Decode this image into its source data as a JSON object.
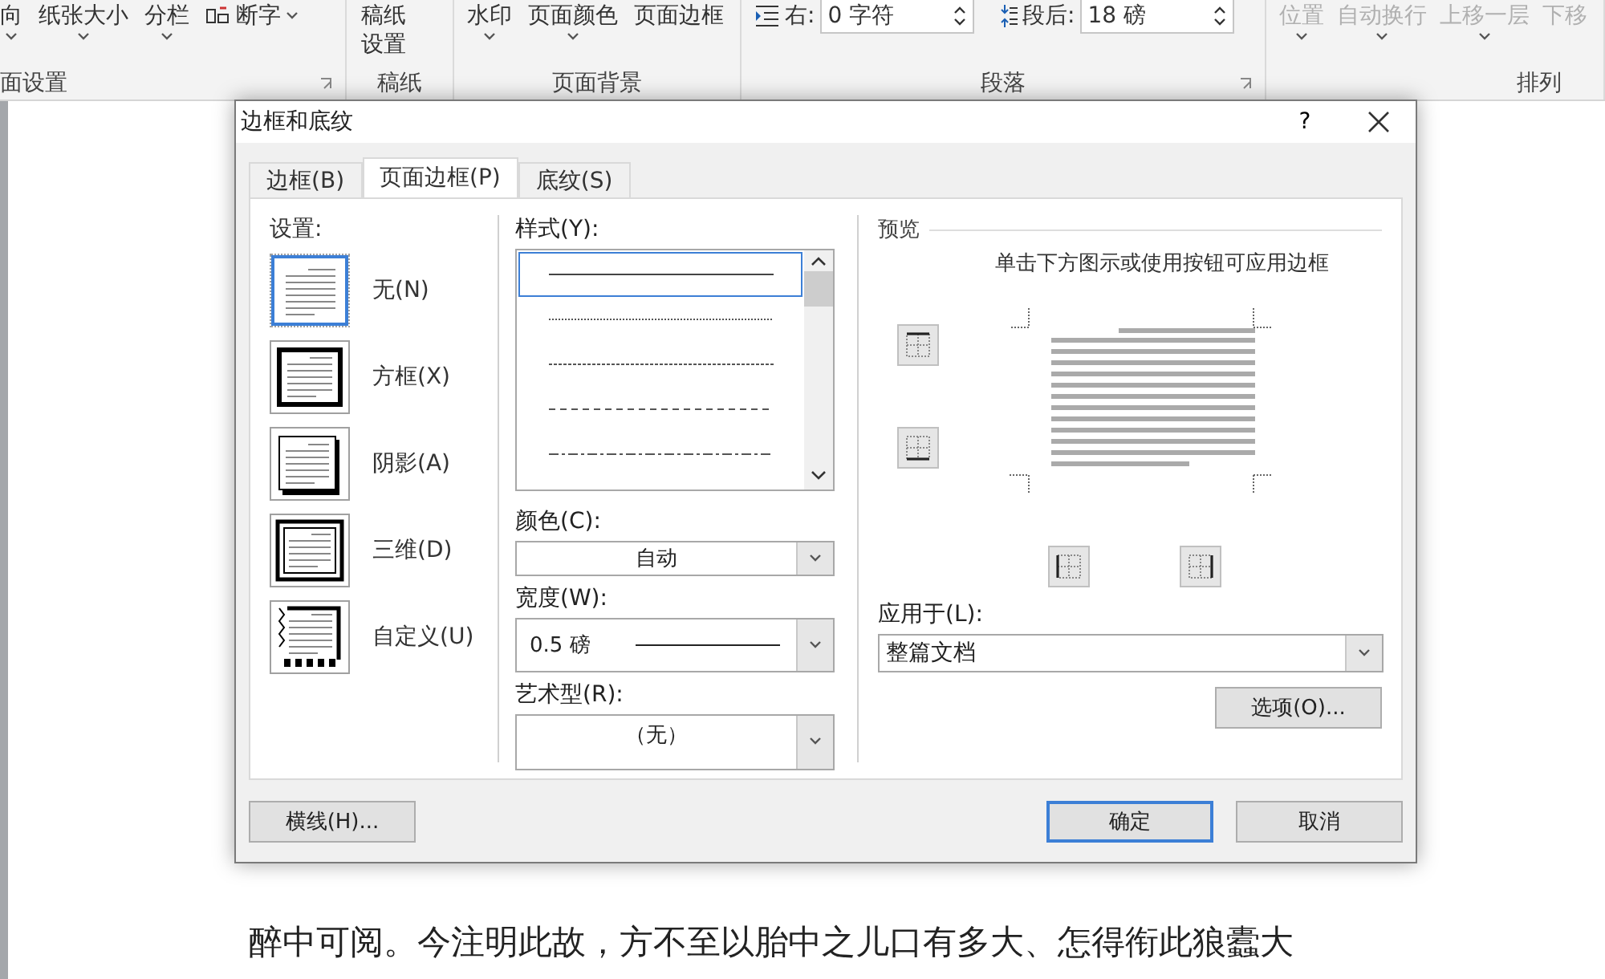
{
  "ribbon": {
    "groups": [
      {
        "label": "面设置",
        "items": [
          {
            "label": "向",
            "kind": "dropdown"
          },
          {
            "label": "纸张大小",
            "kind": "dropdown"
          },
          {
            "label": "分栏",
            "kind": "dropdown"
          },
          {
            "label": "断字",
            "kind": "hyphen"
          }
        ]
      },
      {
        "label": "稿纸",
        "items": [
          {
            "label": "稿纸设置",
            "kind": "stacked"
          }
        ]
      },
      {
        "label": "页面背景",
        "items": [
          {
            "label": "水印",
            "kind": "dropdown"
          },
          {
            "label": "页面颜色",
            "kind": "dropdown"
          },
          {
            "label": "页面边框",
            "kind": "button"
          }
        ]
      },
      {
        "label": "段落",
        "fields": [
          {
            "label": "右:",
            "value": "0 字符",
            "kind": "indent"
          },
          {
            "label": "段后:",
            "value": "18 磅",
            "kind": "spacing"
          }
        ]
      },
      {
        "label": "排列",
        "items": [
          {
            "label": "位置",
            "kind": "dropdown",
            "disabled": true
          },
          {
            "label": "自动换行",
            "kind": "dropdown",
            "disabled": true
          },
          {
            "label": "上移一层",
            "kind": "dropdown",
            "disabled": true
          },
          {
            "label": "下移",
            "kind": "button",
            "disabled": true
          }
        ]
      }
    ]
  },
  "document": {
    "lines": [
      "醉中可阅。今注明此故，方不至以胎中之儿口有多大、怎得衔此狼蠹大"
    ]
  },
  "dialog": {
    "title": "边框和底纹",
    "help": "?",
    "tabs": [
      {
        "label": "边框(B)",
        "selected": false
      },
      {
        "label": "页面边框(P)",
        "selected": true
      },
      {
        "label": "底纹(S)",
        "selected": false
      }
    ],
    "setting": {
      "label": "设置:",
      "items": [
        {
          "label": "无(N)",
          "kind": "none",
          "selected": true
        },
        {
          "label": "方框(X)",
          "kind": "box",
          "selected": false
        },
        {
          "label": "阴影(A)",
          "kind": "shadow",
          "selected": false
        },
        {
          "label": "三维(D)",
          "kind": "raised",
          "selected": false
        },
        {
          "label": "自定义(U)",
          "kind": "custom",
          "selected": false
        }
      ]
    },
    "style": {
      "label": "样式(Y):",
      "options": [
        {
          "kind": "solid",
          "selected": true
        },
        {
          "kind": "dotted",
          "selected": false
        },
        {
          "kind": "fine-dash",
          "selected": false
        },
        {
          "kind": "dash",
          "selected": false
        },
        {
          "kind": "dash-dot",
          "selected": false
        }
      ]
    },
    "color": {
      "label": "颜色(C):",
      "value": "自动"
    },
    "width": {
      "label": "宽度(W):",
      "value": "0.5 磅"
    },
    "art": {
      "label": "艺术型(R):",
      "value": "（无）"
    },
    "preview": {
      "label": "预览",
      "hint": "单击下方图示或使用按钮可应用边框"
    },
    "apply_to": {
      "label": "应用于(L):",
      "value": "整篇文档"
    },
    "options_button": "选项(O)...",
    "buttons": [
      {
        "label": "横线(H)...",
        "kind": "left"
      },
      {
        "label": "确定",
        "kind": "default"
      },
      {
        "label": "取消",
        "kind": "normal"
      }
    ]
  }
}
